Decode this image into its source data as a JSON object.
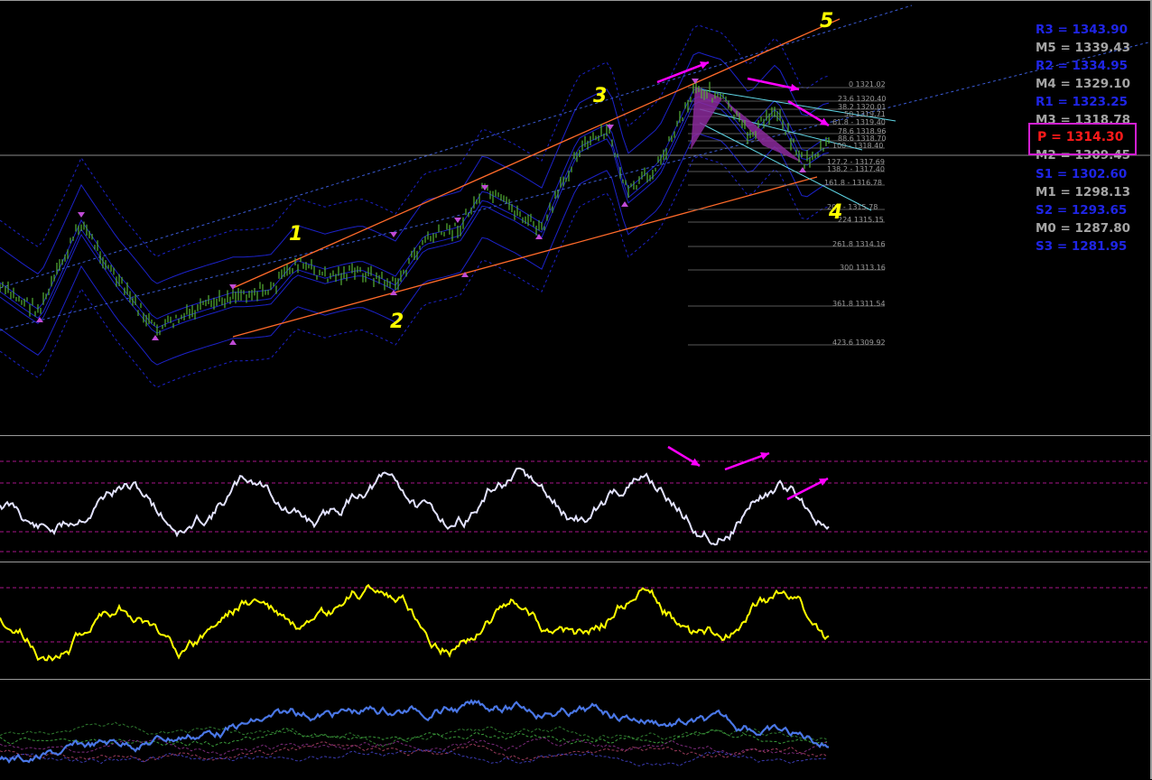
{
  "pivots": [
    {
      "key": "R3",
      "text": "R3 = 1343.90",
      "color": "blue"
    },
    {
      "key": "M5",
      "text": "M5 = 1339.43",
      "color": "gray"
    },
    {
      "key": "R2",
      "text": "R2 = 1334.95",
      "color": "blue"
    },
    {
      "key": "M4",
      "text": "M4 = 1329.10",
      "color": "gray"
    },
    {
      "key": "R1",
      "text": "R1 = 1323.25",
      "color": "blue"
    },
    {
      "key": "M3",
      "text": "M3 = 1318.78",
      "color": "gray"
    },
    {
      "key": "M2",
      "text": "M2 = 1309.45",
      "color": "gray"
    },
    {
      "key": "S1",
      "text": "S1 = 1302.60",
      "color": "blue"
    },
    {
      "key": "M1",
      "text": "M1 = 1298.13",
      "color": "gray"
    },
    {
      "key": "S2",
      "text": "S2 = 1293.65",
      "color": "blue"
    },
    {
      "key": "M0",
      "text": "M0 = 1287.80",
      "color": "gray"
    },
    {
      "key": "S3",
      "text": "S3 = 1281.95",
      "color": "blue"
    }
  ],
  "pivot_main": {
    "text": "P   = 1314.30",
    "color": "#ff1a1a"
  },
  "wave_labels": [
    "1",
    "2",
    "3",
    "4",
    "5"
  ],
  "fib_levels": [
    {
      "text": "0 1321.02"
    },
    {
      "text": "23.6 1320.40"
    },
    {
      "text": "38.2 1320.01"
    },
    {
      "text": "50 1319.71"
    },
    {
      "text": "61.8 - 1319.40"
    },
    {
      "text": "78.6 1318.96"
    },
    {
      "text": "88.6 1318.70"
    },
    {
      "text": "100 - 1318.40"
    },
    {
      "text": "127.2 - 1317.69"
    },
    {
      "text": "138.2 - 1317.40"
    },
    {
      "text": "161.8 - 1316.78"
    },
    {
      "text": "200 - 1315.78"
    },
    {
      "text": "224 1315.15"
    },
    {
      "text": "261.8 1314.16"
    },
    {
      "text": "300 1313.16"
    },
    {
      "text": "361.8 1311.54"
    },
    {
      "text": "423.6 1309.92"
    }
  ],
  "colors": {
    "candles": "#55b034",
    "channel": "#ff6a2a",
    "trend_dotted": "#3b5bd6",
    "bands": "#1c22c9",
    "pattern_fill": "#8b2a9b",
    "arrows": "#ff00ff",
    "osc1": "#e2e2ff",
    "osc2": "#ffff00",
    "osc3": "#4a77e6",
    "cyan_lines": "#5fd6e6",
    "levels": "#a8148a"
  },
  "chart_data": {
    "type": "line",
    "title": "",
    "xlabel": "",
    "ylabel": "",
    "ylim": [
      1309.92,
      1321.02
    ],
    "series": [
      {
        "values": [
          1313.2,
          1312.6,
          1314.3,
          1313.7,
          1312.3,
          1312.5,
          1313.2,
          1313.4,
          1314.0,
          1314.0,
          1314.5,
          1315.2,
          1314.6,
          1314.8,
          1315.3,
          1316.7,
          1316.9,
          1317.0,
          1317.2,
          1318.4,
          1318.2,
          1318.9,
          1320.9,
          1320.2,
          1319.9,
          1319.0,
          1319.6,
          1318.8
        ]
      }
    ]
  }
}
